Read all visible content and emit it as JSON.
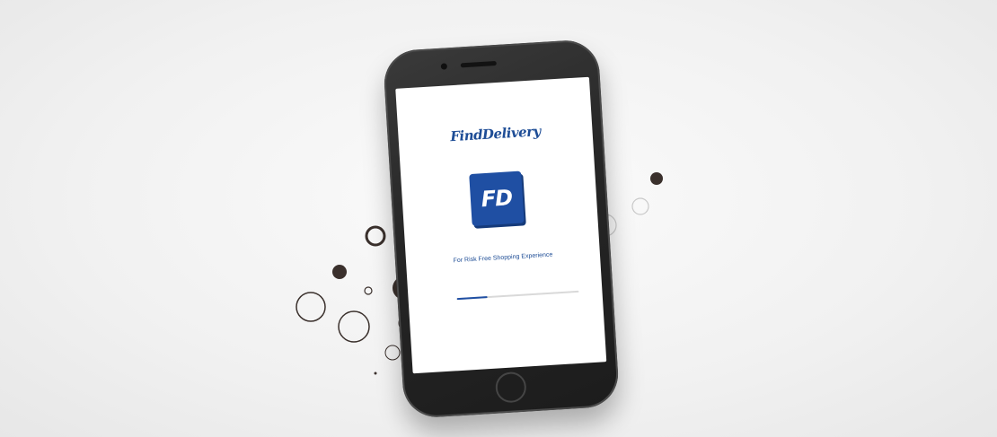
{
  "app": {
    "brand_title": "FindDelivery",
    "logo_text": "FD",
    "tagline": "For Risk Free Shopping Experience",
    "loading_progress": 0.25
  },
  "colors": {
    "brand_blue": "#1f4fa3",
    "phone_body": "#262626",
    "background": "#f1f1f1"
  }
}
